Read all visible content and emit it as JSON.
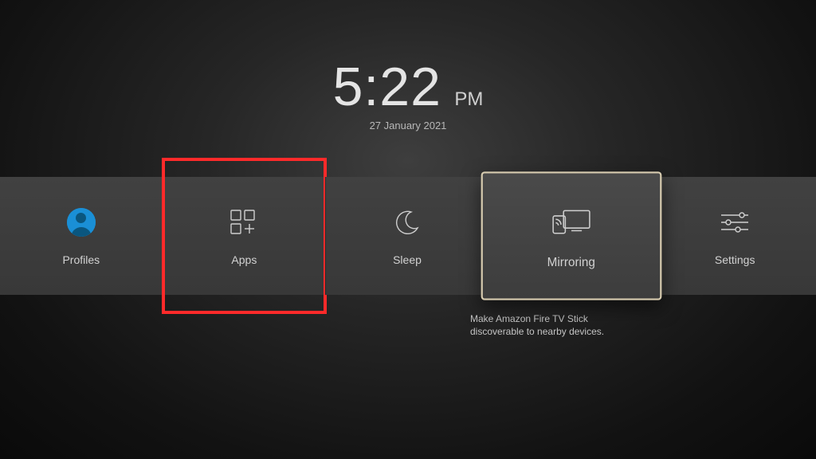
{
  "clock": {
    "time": "5:22",
    "meridiem": "PM",
    "date": "27 January 2021"
  },
  "tiles": {
    "profiles": {
      "label": "Profiles"
    },
    "apps": {
      "label": "Apps"
    },
    "sleep": {
      "label": "Sleep"
    },
    "mirroring": {
      "label": "Mirroring"
    },
    "settings": {
      "label": "Settings"
    }
  },
  "help": {
    "mirroring": "Make Amazon Fire TV Stick discoverable to nearby devices."
  }
}
